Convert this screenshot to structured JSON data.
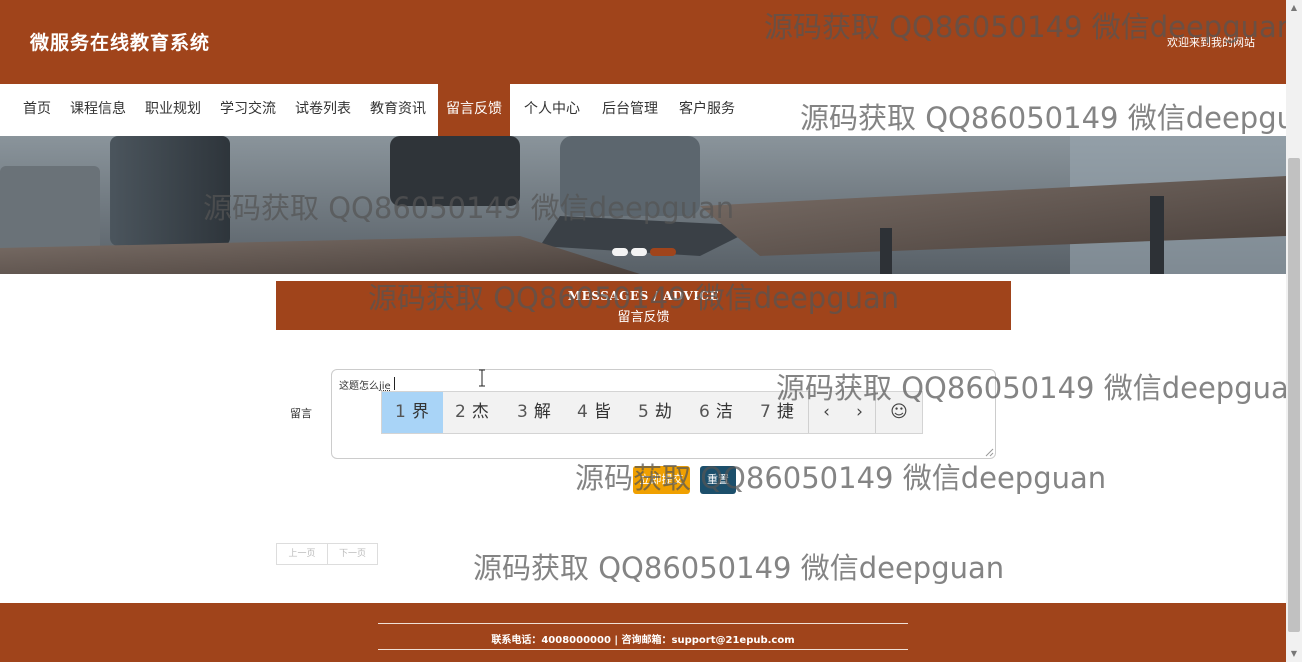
{
  "header": {
    "site_title": "微服务在线教育系统",
    "welcome_text": "欢迎来到我的网站"
  },
  "nav": {
    "items": [
      {
        "label": "首页"
      },
      {
        "label": "课程信息"
      },
      {
        "label": "职业规划"
      },
      {
        "label": "学习交流"
      },
      {
        "label": "试卷列表"
      },
      {
        "label": "教育资讯"
      },
      {
        "label": "留言反馈"
      },
      {
        "label": "个人中心"
      },
      {
        "label": "后台管理"
      },
      {
        "label": "客户服务"
      }
    ],
    "active_label": "留言反馈"
  },
  "banner": {
    "slide_count": 3,
    "active_slide": 3
  },
  "section": {
    "title_en": "MESSAGES / ADVICE",
    "title_cn": "留言反馈"
  },
  "form": {
    "message_label": "留言",
    "message_value": "这题怎么",
    "composition_text": "jie",
    "submit_label": "立即提交",
    "reset_label": "重置"
  },
  "ime": {
    "candidates": [
      {
        "num": "1",
        "char": "界"
      },
      {
        "num": "2",
        "char": "杰"
      },
      {
        "num": "3",
        "char": "解"
      },
      {
        "num": "4",
        "char": "皆"
      },
      {
        "num": "5",
        "char": "劫"
      },
      {
        "num": "6",
        "char": "洁"
      },
      {
        "num": "7",
        "char": "捷"
      }
    ],
    "selected_index": 0,
    "prev_glyph": "‹",
    "next_glyph": "›",
    "emoji_glyph": "☺"
  },
  "pager": {
    "prev_label": "上一页",
    "next_label": "下一页"
  },
  "footer": {
    "contact_text": "联系电话：4008000000 | 咨询邮箱：support@21epub.com"
  },
  "watermark": {
    "text": "源码获取 QQ86050149 微信deepguan"
  },
  "colors": {
    "brand": "#a0441b",
    "submit": "#f0a000",
    "reset": "#1c4f6b",
    "ime_selected": "#a9d4f7"
  }
}
